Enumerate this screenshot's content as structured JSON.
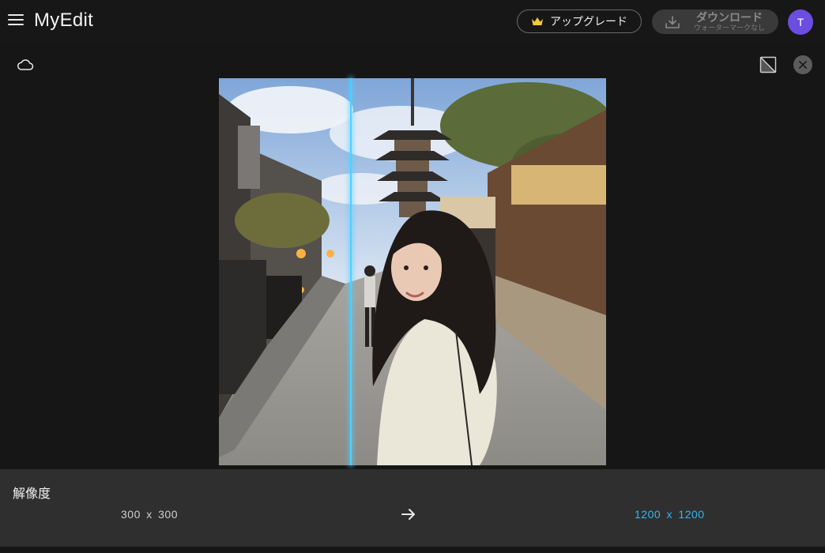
{
  "app": {
    "logo": "MyEdit"
  },
  "header": {
    "upgrade_label": "アップグレード",
    "download_label": "ダウンロード",
    "download_sublabel": "ウォーターマークなし",
    "avatar_initial": "T"
  },
  "panel": {
    "title": "解像度",
    "source_resolution": "300 x 300",
    "target_resolution": "1200 x 1200"
  },
  "colors": {
    "accent_blue": "#35b6ef",
    "divider": "#4fd0ff",
    "avatar_bg": "#6b4de0",
    "crown": "#f6c834"
  },
  "comparison": {
    "divider_position_fraction": 0.34
  }
}
